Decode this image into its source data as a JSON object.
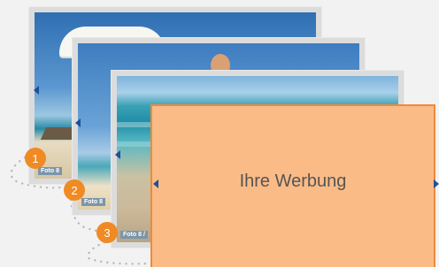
{
  "slides": [
    {
      "label": "Foto 8",
      "marker": "1"
    },
    {
      "label": "Foto 8",
      "marker": "2"
    },
    {
      "label": "Foto 8 /",
      "marker": "3"
    }
  ],
  "ad": {
    "text": "Ihre Werbung"
  },
  "colors": {
    "marker": "#f08a24",
    "ad_background": "#fbbb86",
    "ad_border": "#ee8a3a",
    "arrow": "#1f4f9a",
    "dots": "#b8b8b8"
  }
}
